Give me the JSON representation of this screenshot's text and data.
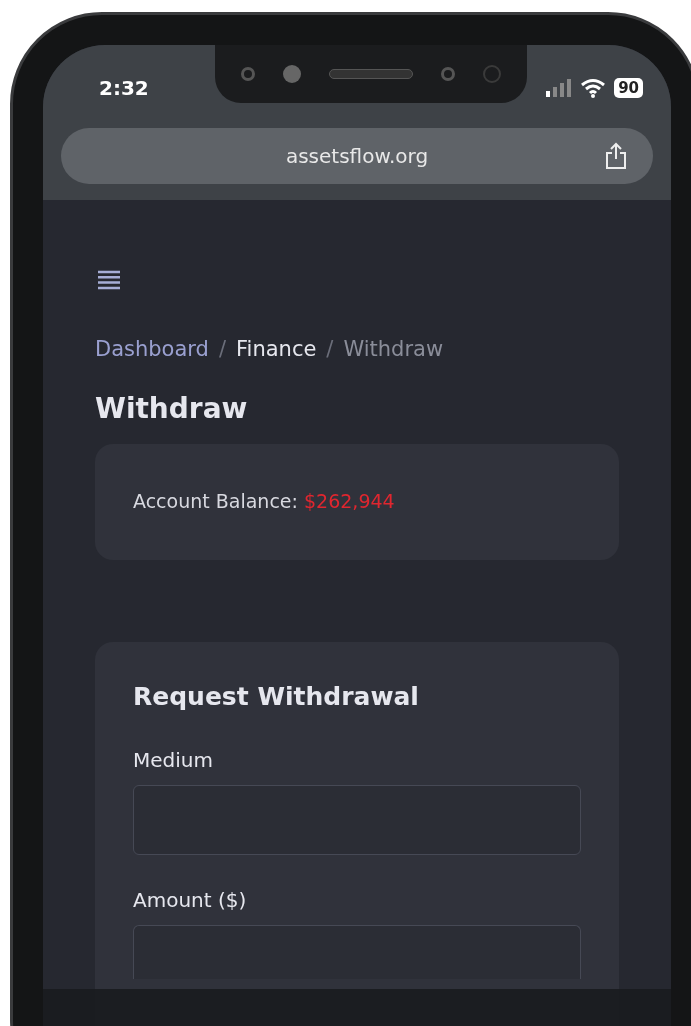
{
  "status_bar": {
    "time": "2:32",
    "battery": "90"
  },
  "browser": {
    "url": "assetsflow.org"
  },
  "breadcrumb": {
    "separator": "/",
    "items": [
      {
        "label": "Dashboard",
        "kind": "link"
      },
      {
        "label": "Finance",
        "kind": "parent"
      },
      {
        "label": "Withdraw",
        "kind": "current"
      }
    ]
  },
  "page_title": "Withdraw",
  "balance_card": {
    "label": "Account Balance:",
    "value": "$262,944"
  },
  "form": {
    "title": "Request Withdrawal",
    "fields": [
      {
        "label": "Medium"
      },
      {
        "label": "Amount ($)"
      }
    ]
  }
}
